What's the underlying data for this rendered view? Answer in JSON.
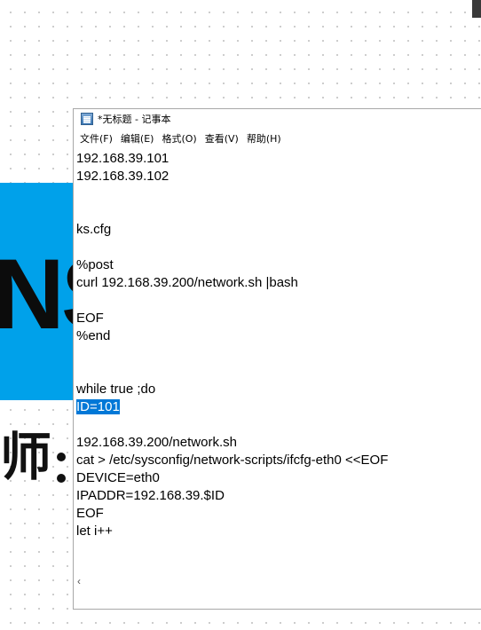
{
  "background": {
    "big_text": "NS",
    "chinese_char": "师",
    "accent": "#00a1ea"
  },
  "window": {
    "title": "*无标题 - 记事本",
    "menu": [
      "文件(F)",
      "编辑(E)",
      "格式(O)",
      "查看(V)",
      "帮助(H)"
    ],
    "lines": [
      "192.168.39.101",
      "192.168.39.102",
      "",
      "",
      "ks.cfg",
      "",
      "%post",
      "curl 192.168.39.200/network.sh |bash",
      "",
      "EOF",
      "%end",
      "",
      "",
      "while true ;do",
      "ID=101",
      "",
      "192.168.39.200/network.sh",
      "cat > /etc/sysconfig/network-scripts/ifcfg-eth0 <<EOF",
      "DEVICE=eth0",
      "IPADDR=192.168.39.$ID",
      "EOF",
      "let i++"
    ],
    "selected_line_index": 14,
    "selection_color": "#0078d7",
    "scroll_left_glyph": "‹"
  }
}
